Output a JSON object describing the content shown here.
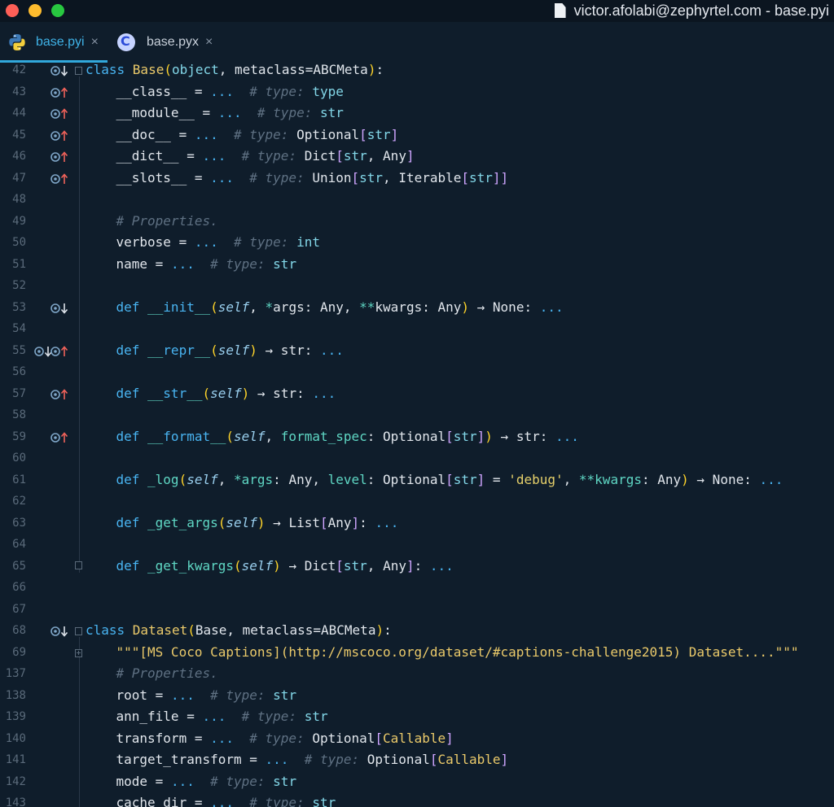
{
  "window": {
    "title": "victor.afolabi@zephyrtel.com - base.pyi",
    "traffic_lights": {
      "close": "#fe5f57",
      "minimize": "#febc2e",
      "zoom": "#28c840"
    }
  },
  "tabs": [
    {
      "label": "base.pyi",
      "icon": "python-icon",
      "active": true,
      "close": "×"
    },
    {
      "label": "base.pyx",
      "icon": "cython-icon",
      "active": false,
      "close": "×"
    }
  ],
  "editor": {
    "theme": {
      "background": "#0f1d2b",
      "keyword": "#49b4f1",
      "class_name": "#ebca6a",
      "comment": "#5f7183"
    },
    "lines": [
      {
        "n": "42",
        "gutter": [
          "override-icon",
          "arrow-down-icon"
        ],
        "fold": "open",
        "indent": 0,
        "tokens": [
          [
            "k",
            "class "
          ],
          [
            "cls",
            "Base"
          ],
          [
            "pr",
            "("
          ],
          [
            "ty",
            "object"
          ],
          [
            "nm",
            ", "
          ],
          [
            "nm",
            "metaclass"
          ],
          [
            "nm",
            "="
          ],
          [
            "nm",
            "ABCMeta"
          ],
          [
            "pr",
            ")"
          ],
          [
            "nm",
            ":"
          ]
        ]
      },
      {
        "n": "43",
        "gutter": [
          "override-icon",
          "arrow-up-icon"
        ],
        "indent": 1,
        "tokens": [
          [
            "nm",
            "__class__ = "
          ],
          [
            "k",
            "..."
          ],
          [
            "nm",
            "  "
          ],
          [
            "cm",
            "# type: "
          ],
          [
            "ty",
            "type"
          ]
        ]
      },
      {
        "n": "44",
        "gutter": [
          "override-icon",
          "arrow-up-icon"
        ],
        "indent": 1,
        "tokens": [
          [
            "nm",
            "__module__ = "
          ],
          [
            "k",
            "..."
          ],
          [
            "nm",
            "  "
          ],
          [
            "cm",
            "# type: "
          ],
          [
            "ty",
            "str"
          ]
        ]
      },
      {
        "n": "45",
        "gutter": [
          "override-icon",
          "arrow-up-icon"
        ],
        "indent": 1,
        "tokens": [
          [
            "nm",
            "__doc__ = "
          ],
          [
            "k",
            "..."
          ],
          [
            "nm",
            "  "
          ],
          [
            "cm",
            "# type: "
          ],
          [
            "nm",
            "Optional"
          ],
          [
            "bk",
            "["
          ],
          [
            "ty",
            "str"
          ],
          [
            "bk",
            "]"
          ]
        ]
      },
      {
        "n": "46",
        "gutter": [
          "override-icon",
          "arrow-up-icon"
        ],
        "indent": 1,
        "tokens": [
          [
            "nm",
            "__dict__ = "
          ],
          [
            "k",
            "..."
          ],
          [
            "nm",
            "  "
          ],
          [
            "cm",
            "# type: "
          ],
          [
            "nm",
            "Dict"
          ],
          [
            "bk",
            "["
          ],
          [
            "ty",
            "str"
          ],
          [
            "nm",
            ", "
          ],
          [
            "nm",
            "Any"
          ],
          [
            "bk",
            "]"
          ]
        ]
      },
      {
        "n": "47",
        "gutter": [
          "override-icon",
          "arrow-up-icon"
        ],
        "indent": 1,
        "tokens": [
          [
            "nm",
            "__slots__ = "
          ],
          [
            "k",
            "..."
          ],
          [
            "nm",
            "  "
          ],
          [
            "cm",
            "# type: "
          ],
          [
            "nm",
            "Union"
          ],
          [
            "bk",
            "["
          ],
          [
            "ty",
            "str"
          ],
          [
            "nm",
            ", "
          ],
          [
            "nm",
            "Iterable"
          ],
          [
            "bk",
            "["
          ],
          [
            "ty",
            "str"
          ],
          [
            "bk",
            "]]"
          ]
        ]
      },
      {
        "n": "48",
        "gutter": [],
        "indent": 1,
        "tokens": []
      },
      {
        "n": "49",
        "gutter": [],
        "indent": 1,
        "tokens": [
          [
            "cm",
            "# Properties."
          ]
        ]
      },
      {
        "n": "50",
        "gutter": [],
        "indent": 1,
        "tokens": [
          [
            "nm",
            "verbose = "
          ],
          [
            "k",
            "..."
          ],
          [
            "nm",
            "  "
          ],
          [
            "cm",
            "# type: "
          ],
          [
            "ty",
            "int"
          ]
        ]
      },
      {
        "n": "51",
        "gutter": [],
        "indent": 1,
        "tokens": [
          [
            "nm",
            "name = "
          ],
          [
            "k",
            "..."
          ],
          [
            "nm",
            "  "
          ],
          [
            "cm",
            "# type: "
          ],
          [
            "ty",
            "str"
          ]
        ]
      },
      {
        "n": "52",
        "gutter": [],
        "indent": 1,
        "tokens": []
      },
      {
        "n": "53",
        "gutter": [
          "override-icon",
          "arrow-down-icon"
        ],
        "indent": 1,
        "tokens": [
          [
            "k",
            "def "
          ],
          [
            "ag",
            "__"
          ],
          [
            "k",
            "init"
          ],
          [
            "ag",
            "__"
          ],
          [
            "pr",
            "("
          ],
          [
            "se",
            "self"
          ],
          [
            "nm",
            ", "
          ],
          [
            "ag",
            "*"
          ],
          [
            "nm",
            "args: Any, "
          ],
          [
            "ag",
            "**"
          ],
          [
            "nm",
            "kwargs: Any"
          ],
          [
            "pr",
            ")"
          ],
          [
            "nm",
            " → None: "
          ],
          [
            "k",
            "..."
          ]
        ]
      },
      {
        "n": "54",
        "gutter": [],
        "indent": 1,
        "tokens": []
      },
      {
        "n": "55",
        "gutter": [
          "override-icon",
          "arrow-down-icon",
          "override-icon",
          "arrow-up-icon"
        ],
        "indent": 1,
        "tokens": [
          [
            "k",
            "def "
          ],
          [
            "ag",
            "__"
          ],
          [
            "k",
            "repr"
          ],
          [
            "ag",
            "__"
          ],
          [
            "pr",
            "("
          ],
          [
            "se",
            "self"
          ],
          [
            "pr",
            ")"
          ],
          [
            "nm",
            " → str: "
          ],
          [
            "k",
            "..."
          ]
        ]
      },
      {
        "n": "56",
        "gutter": [],
        "indent": 1,
        "tokens": []
      },
      {
        "n": "57",
        "gutter": [
          "override-icon",
          "arrow-up-icon"
        ],
        "indent": 1,
        "tokens": [
          [
            "k",
            "def "
          ],
          [
            "ag",
            "__"
          ],
          [
            "k",
            "str"
          ],
          [
            "ag",
            "__"
          ],
          [
            "pr",
            "("
          ],
          [
            "se",
            "self"
          ],
          [
            "pr",
            ")"
          ],
          [
            "nm",
            " → str: "
          ],
          [
            "k",
            "..."
          ]
        ]
      },
      {
        "n": "58",
        "gutter": [],
        "indent": 1,
        "tokens": []
      },
      {
        "n": "59",
        "gutter": [
          "override-icon",
          "arrow-up-icon"
        ],
        "indent": 1,
        "tokens": [
          [
            "k",
            "def "
          ],
          [
            "ag",
            "__"
          ],
          [
            "k",
            "format"
          ],
          [
            "ag",
            "__"
          ],
          [
            "pr",
            "("
          ],
          [
            "se",
            "self"
          ],
          [
            "nm",
            ", "
          ],
          [
            "ag",
            "format_spec"
          ],
          [
            "nm",
            ": Optional"
          ],
          [
            "bk",
            "["
          ],
          [
            "ty",
            "str"
          ],
          [
            "bk",
            "]"
          ],
          [
            "pr",
            ")"
          ],
          [
            "nm",
            " → str: "
          ],
          [
            "k",
            "..."
          ]
        ]
      },
      {
        "n": "60",
        "gutter": [],
        "indent": 1,
        "tokens": []
      },
      {
        "n": "61",
        "gutter": [],
        "indent": 1,
        "tokens": [
          [
            "k",
            "def "
          ],
          [
            "ag",
            "_log"
          ],
          [
            "pr",
            "("
          ],
          [
            "se",
            "self"
          ],
          [
            "nm",
            ", "
          ],
          [
            "ag",
            "*args"
          ],
          [
            "nm",
            ": Any, "
          ],
          [
            "ag",
            "level"
          ],
          [
            "nm",
            ": Optional"
          ],
          [
            "bk",
            "["
          ],
          [
            "ty",
            "str"
          ],
          [
            "bk",
            "]"
          ],
          [
            "nm",
            " = "
          ],
          [
            "sq",
            "'debug'"
          ],
          [
            "nm",
            ", "
          ],
          [
            "ag",
            "**kwargs"
          ],
          [
            "nm",
            ": Any"
          ],
          [
            "pr",
            ")"
          ],
          [
            "nm",
            " → None: "
          ],
          [
            "k",
            "..."
          ]
        ]
      },
      {
        "n": "62",
        "gutter": [],
        "indent": 1,
        "tokens": []
      },
      {
        "n": "63",
        "gutter": [],
        "indent": 1,
        "tokens": [
          [
            "k",
            "def "
          ],
          [
            "ag",
            "_get_args"
          ],
          [
            "pr",
            "("
          ],
          [
            "se",
            "self"
          ],
          [
            "pr",
            ")"
          ],
          [
            "nm",
            " → List"
          ],
          [
            "bk",
            "["
          ],
          [
            "nm",
            "Any"
          ],
          [
            "bk",
            "]"
          ],
          [
            "nm",
            ": "
          ],
          [
            "k",
            "..."
          ]
        ]
      },
      {
        "n": "64",
        "gutter": [],
        "indent": 1,
        "tokens": []
      },
      {
        "n": "65",
        "gutter": [],
        "fold": "end",
        "indent": 1,
        "tokens": [
          [
            "k",
            "def "
          ],
          [
            "ag",
            "_get_kwargs"
          ],
          [
            "pr",
            "("
          ],
          [
            "se",
            "self"
          ],
          [
            "pr",
            ")"
          ],
          [
            "nm",
            " → Dict"
          ],
          [
            "bk",
            "["
          ],
          [
            "ty",
            "str"
          ],
          [
            "nm",
            ", Any"
          ],
          [
            "bk",
            "]"
          ],
          [
            "nm",
            ": "
          ],
          [
            "k",
            "..."
          ]
        ]
      },
      {
        "n": "66",
        "gutter": [],
        "indent": 0,
        "tokens": []
      },
      {
        "n": "67",
        "gutter": [],
        "indent": 0,
        "tokens": []
      },
      {
        "n": "68",
        "gutter": [
          "override-icon",
          "arrow-down-icon"
        ],
        "fold": "open",
        "indent": 0,
        "tokens": [
          [
            "k",
            "class "
          ],
          [
            "cls",
            "Dataset"
          ],
          [
            "pr",
            "("
          ],
          [
            "nm",
            "Base, "
          ],
          [
            "nm",
            "metaclass"
          ],
          [
            "nm",
            "="
          ],
          [
            "nm",
            "ABCMeta"
          ],
          [
            "pr",
            ")"
          ],
          [
            "nm",
            ":"
          ]
        ]
      },
      {
        "n": "69",
        "gutter": [],
        "fold": "plus",
        "indent": 1,
        "tokens": [
          [
            "st",
            "\"\"\"[MS Coco Captions](http://mscoco.org/dataset/#captions-challenge2015) Dataset....\"\"\""
          ]
        ]
      },
      {
        "n": "137",
        "gutter": [],
        "indent": 1,
        "tokens": [
          [
            "cm",
            "# Properties."
          ]
        ]
      },
      {
        "n": "138",
        "gutter": [],
        "indent": 1,
        "tokens": [
          [
            "nm",
            "root = "
          ],
          [
            "k",
            "..."
          ],
          [
            "nm",
            "  "
          ],
          [
            "cm",
            "# type: "
          ],
          [
            "ty",
            "str"
          ]
        ]
      },
      {
        "n": "139",
        "gutter": [],
        "indent": 1,
        "tokens": [
          [
            "nm",
            "ann_file = "
          ],
          [
            "k",
            "..."
          ],
          [
            "nm",
            "  "
          ],
          [
            "cm",
            "# type: "
          ],
          [
            "ty",
            "str"
          ]
        ]
      },
      {
        "n": "140",
        "gutter": [],
        "indent": 1,
        "tokens": [
          [
            "nm",
            "transform = "
          ],
          [
            "k",
            "..."
          ],
          [
            "nm",
            "  "
          ],
          [
            "cm",
            "# type: "
          ],
          [
            "nm",
            "Optional"
          ],
          [
            "bk",
            "["
          ],
          [
            "cls",
            "Callable"
          ],
          [
            "bk",
            "]"
          ]
        ]
      },
      {
        "n": "141",
        "gutter": [],
        "indent": 1,
        "tokens": [
          [
            "nm",
            "target_transform = "
          ],
          [
            "k",
            "..."
          ],
          [
            "nm",
            "  "
          ],
          [
            "cm",
            "# type: "
          ],
          [
            "nm",
            "Optional"
          ],
          [
            "bk",
            "["
          ],
          [
            "cls",
            "Callable"
          ],
          [
            "bk",
            "]"
          ]
        ]
      },
      {
        "n": "142",
        "gutter": [],
        "indent": 1,
        "tokens": [
          [
            "nm",
            "mode = "
          ],
          [
            "k",
            "..."
          ],
          [
            "nm",
            "  "
          ],
          [
            "cm",
            "# type: "
          ],
          [
            "ty",
            "str"
          ]
        ]
      },
      {
        "n": "143",
        "gutter": [],
        "indent": 1,
        "tokens": [
          [
            "nm",
            "cache_dir = "
          ],
          [
            "k",
            "..."
          ],
          [
            "nm",
            "  "
          ],
          [
            "cm",
            "# type: "
          ],
          [
            "ty",
            "str"
          ]
        ]
      }
    ]
  }
}
